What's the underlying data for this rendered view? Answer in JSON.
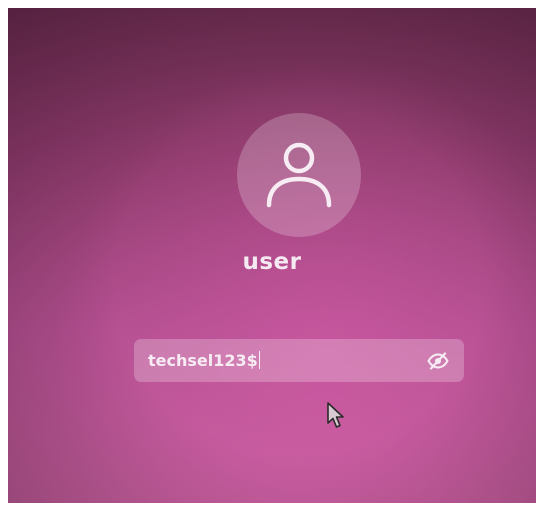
{
  "login": {
    "avatar_icon": "user-icon",
    "username": "user",
    "password_value": "techsel123$",
    "reveal_icon": "eye-slash-icon"
  },
  "pointer": {
    "icon": "mouse-pointer-icon"
  },
  "colors": {
    "background_top": "#6e2e52",
    "background_bottom": "#c7609f",
    "text": "#f6eaf2"
  }
}
